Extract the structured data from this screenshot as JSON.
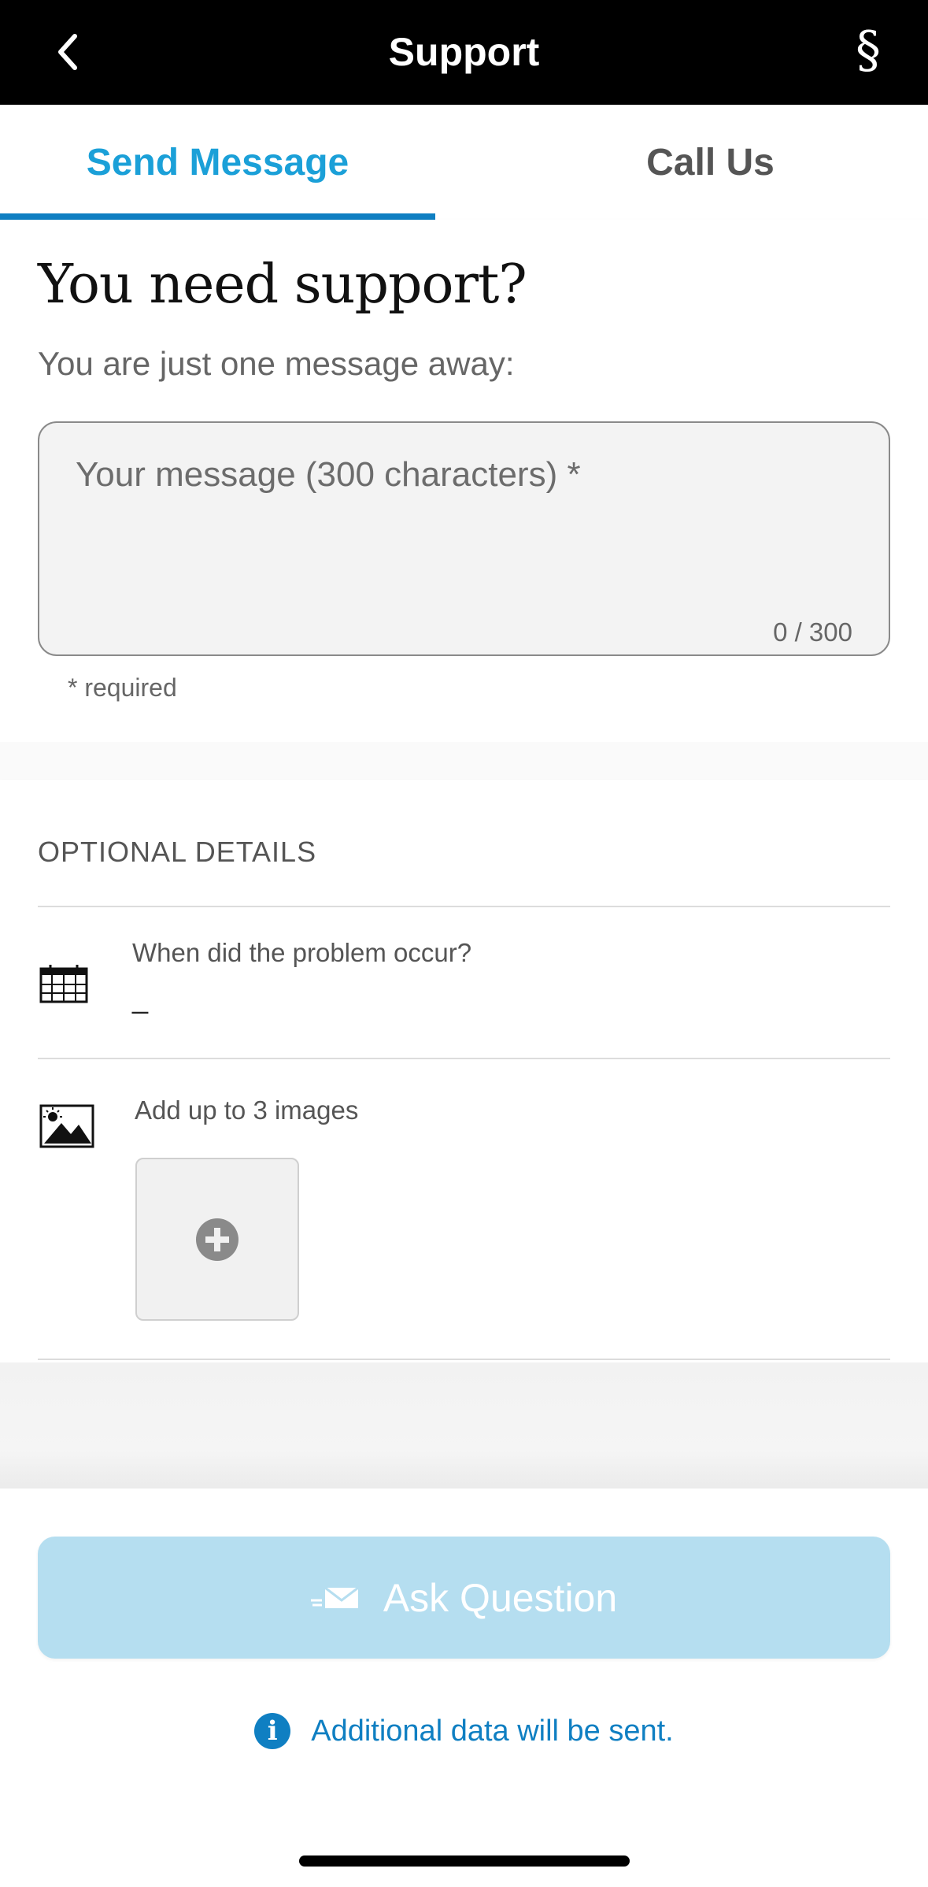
{
  "header": {
    "title": "Support",
    "back_icon": "chevron-left-icon",
    "legal_icon": "section-sign-icon",
    "legal_glyph": "§"
  },
  "tabs": [
    {
      "label": "Send Message",
      "active": true
    },
    {
      "label": "Call Us",
      "active": false
    }
  ],
  "message_section": {
    "heading": "You need support?",
    "subheading": "You are just one message away:",
    "textarea_placeholder": "Your message (300 characters) *",
    "counter": "0 / 300",
    "required_note": "* required"
  },
  "optional_details": {
    "title": "OPTIONAL DETAILS",
    "date_label": "When did the problem occur?",
    "date_value": "_",
    "date_icon": "calendar-icon",
    "images_label": "Add up to 3 images",
    "images_icon": "image-icon",
    "add_image_icon": "plus-circle-icon"
  },
  "actions": {
    "ask_question_label": "Ask Question",
    "ask_icon": "mail-send-icon",
    "info_text": "Additional data will be sent.",
    "info_glyph": "i"
  },
  "colors": {
    "accent": "#1ba0d8",
    "tab_indicator": "#0f7fc2",
    "button_disabled": "#b5def0",
    "header_bg": "#000000"
  }
}
